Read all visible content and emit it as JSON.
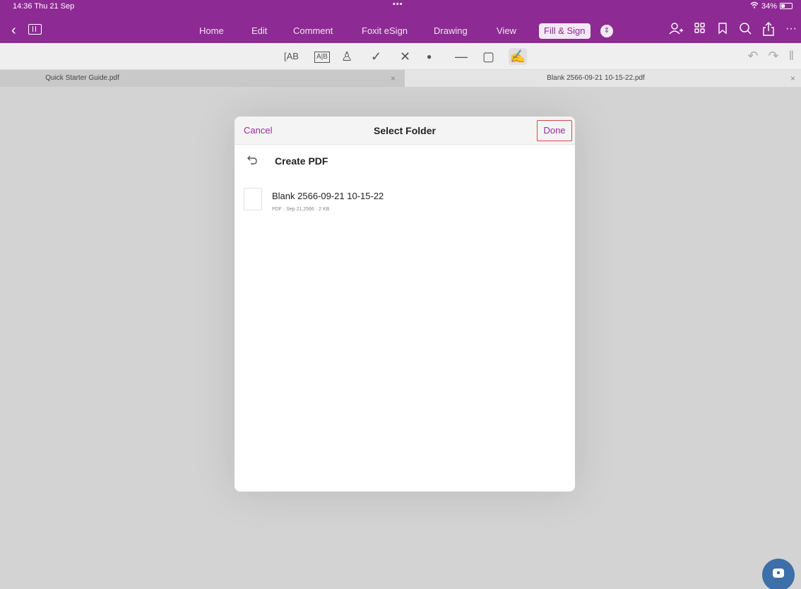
{
  "status_bar": {
    "time": "14:36  Thu 21 Sep",
    "dots": "•••",
    "wifi_icon": "wifi-icon",
    "battery": "34%",
    "battery_level": 0.34
  },
  "nav": {
    "back_icon": "chevron-left-icon",
    "sidebar_icon": "sidebar-panel-icon",
    "tabs": [
      {
        "label": "Home"
      },
      {
        "label": "Edit"
      },
      {
        "label": "Comment"
      },
      {
        "label": "Foxit eSign"
      },
      {
        "label": "Drawing"
      },
      {
        "label": "View"
      },
      {
        "label": "Fill & Sign",
        "active": true
      }
    ],
    "more_tabs_icon": "chevron-updown-icon",
    "right_icons": [
      "add-user-icon",
      "grid-icon",
      "bookmark-icon",
      "search-icon",
      "share-icon",
      "more-icon"
    ]
  },
  "fill_sign_toolbar": {
    "tools": [
      {
        "name": "text-field-icon",
        "glyph": "[AB"
      },
      {
        "name": "comb-text-icon",
        "glyph": "A|B"
      },
      {
        "name": "profile-icon",
        "glyph": "♙"
      },
      {
        "name": "checkmark-icon",
        "glyph": "✓"
      },
      {
        "name": "cross-icon",
        "glyph": "✕"
      },
      {
        "name": "dot-icon",
        "glyph": "●"
      },
      {
        "name": "line-icon",
        "glyph": "—"
      },
      {
        "name": "rectangle-icon",
        "glyph": "▢"
      },
      {
        "name": "sign-pen-icon",
        "glyph": "✍"
      }
    ],
    "undo_icons": [
      "undo-icon",
      "redo-icon",
      "collapse-icon"
    ]
  },
  "document_tabs": [
    {
      "title": "Quick Starter Guide.pdf",
      "close": "×"
    },
    {
      "title": "Blank 2566-09-21 10-15-22.pdf",
      "close": "×"
    }
  ],
  "dialog": {
    "cancel_label": "Cancel",
    "title": "Select Folder",
    "done_label": "Done",
    "folder_back_icon": "back-arrow-icon",
    "current_folder": "Create PDF",
    "files": [
      {
        "name": "Blank 2566-09-21 10-15-22",
        "meta": "PDF · Sep 21,2566 · 2 KB"
      }
    ]
  },
  "floating_button": {
    "icon": "chat-bubble-icon"
  }
}
